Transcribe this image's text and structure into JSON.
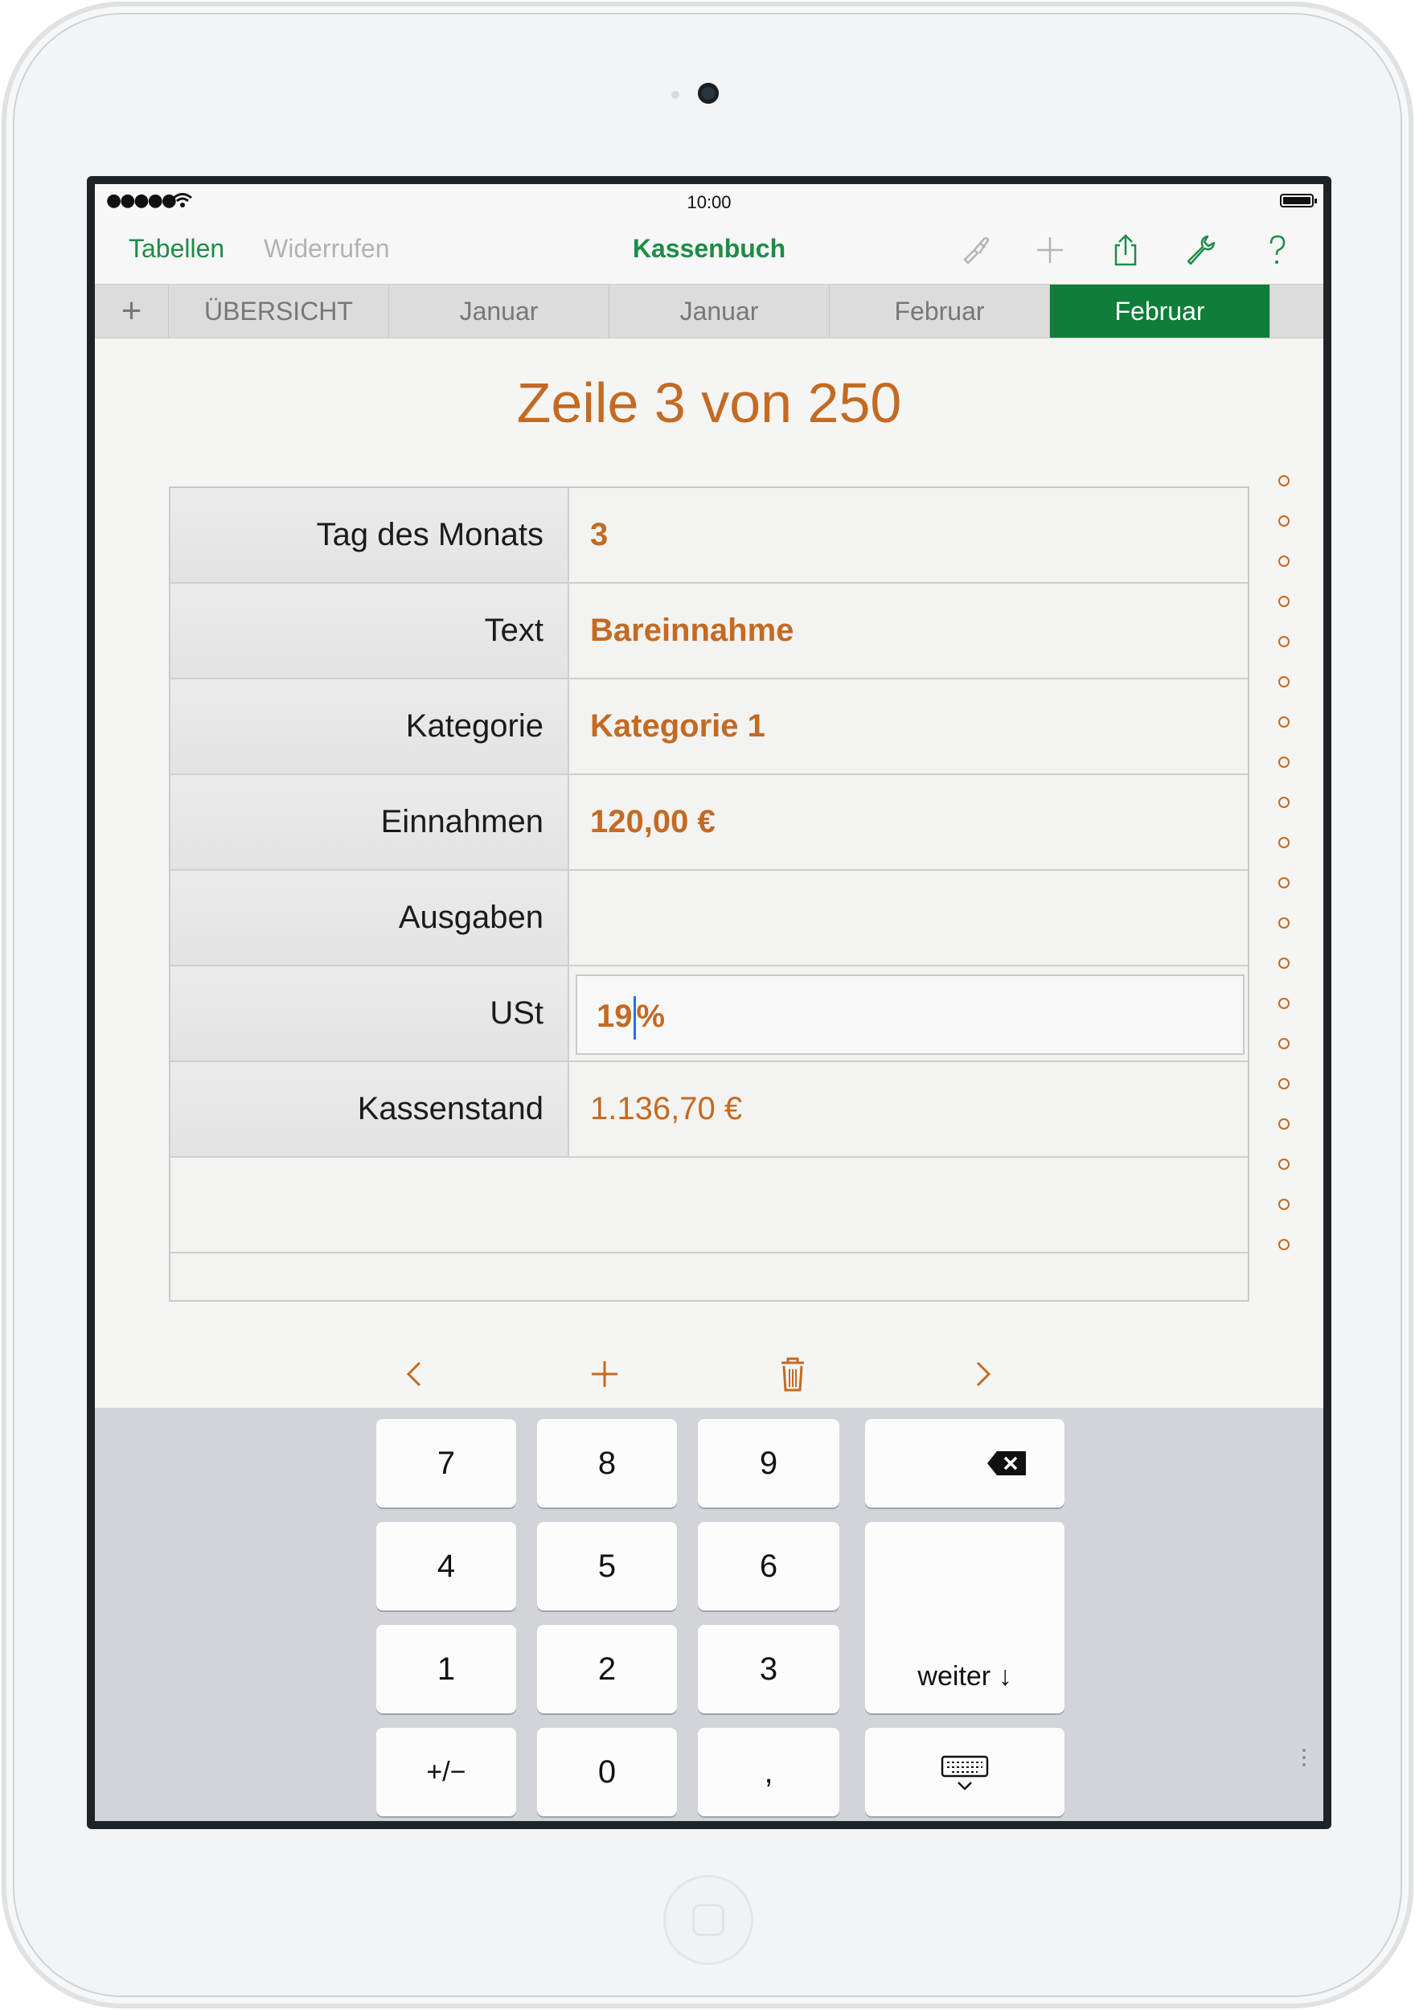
{
  "status_bar": {
    "signal": "●●●●●",
    "time": "10:00"
  },
  "nav": {
    "tables_label": "Tabellen",
    "undo_label": "Widerrufen",
    "document_title": "Kassenbuch",
    "help_label": "?"
  },
  "tabs": {
    "add_label": "+",
    "items": [
      {
        "label": "ÜBERSICHT"
      },
      {
        "label": "Januar"
      },
      {
        "label": "Januar"
      },
      {
        "label": "Februar"
      },
      {
        "label": "Februar",
        "selected": true
      }
    ]
  },
  "form": {
    "title": "Zeile 3 von 250",
    "fields": [
      {
        "label": "Tag des Monats",
        "value": "3"
      },
      {
        "label": "Text",
        "value": "Bareinnahme"
      },
      {
        "label": "Kategorie",
        "value": "Kategorie 1"
      },
      {
        "label": "Einnahmen",
        "value": "120,00 €"
      },
      {
        "label": "Ausgaben",
        "value": ""
      },
      {
        "label": "USt",
        "value_before_cursor": "19",
        "value_after_cursor": "%"
      },
      {
        "label": "Kassenstand",
        "value": "1.136,70 €"
      }
    ]
  },
  "keyboard": {
    "keys": [
      "7",
      "8",
      "9",
      "4",
      "5",
      "6",
      "1",
      "2",
      "3",
      "+/−",
      "0",
      ","
    ],
    "next_label": "weiter ↓"
  },
  "colors": {
    "accent_green": "#1e8c48",
    "selected_tab": "#0e7e3a",
    "value_orange": "#c46a22",
    "cursor_blue": "#2c6cf0"
  },
  "icons": {
    "toolbar": [
      "brush-icon",
      "plus-icon",
      "share-icon",
      "wrench-icon",
      "help-icon"
    ],
    "form_toolbar": [
      "chevron-left-icon",
      "plus-icon",
      "trash-icon",
      "chevron-right-icon"
    ],
    "keyboard": [
      "backspace-icon",
      "keyboard-dismiss-icon"
    ]
  }
}
